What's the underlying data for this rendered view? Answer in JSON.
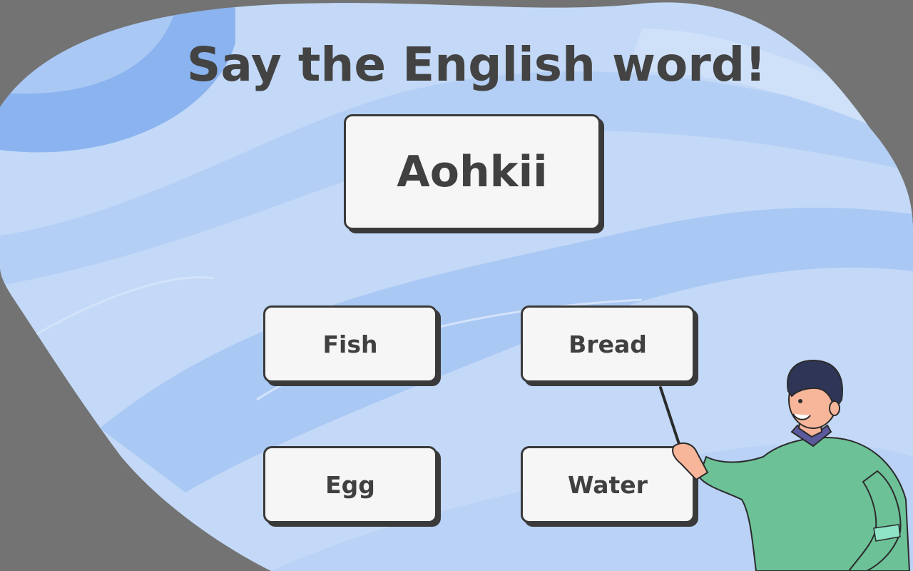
{
  "game": {
    "title": "Say the English word!",
    "prompt_word": "Aohkii",
    "answers": [
      {
        "label": "Fish"
      },
      {
        "label": "Bread"
      },
      {
        "label": "Egg"
      },
      {
        "label": "Water"
      }
    ]
  },
  "colors": {
    "frame_gray": "#737373",
    "blob_light_blue": "#c3d9f7",
    "blob_mid_blue": "#aac8f4",
    "blob_deep_blue": "#8ab3ef",
    "card_fill": "#f6f6f6",
    "card_border": "#3a3a3a",
    "text_dark": "#434343",
    "sweater_green": "#6cc197",
    "collar_purple": "#5b5a9c",
    "hair_navy": "#2f3556",
    "skin": "#f7b69a"
  },
  "icons": {
    "character": "teacher-with-pointer"
  }
}
